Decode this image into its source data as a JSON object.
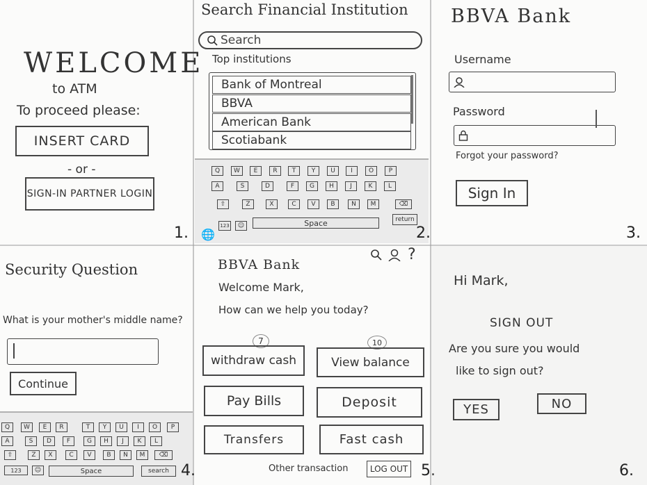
{
  "p1": {
    "title": "WELCOME",
    "subtitle": "to ATM",
    "proceed": "To proceed please:",
    "insert_card": "INSERT CARD",
    "or": "- or -",
    "signin_partner": "SIGN-IN PARTNER LOGIN",
    "number": "1."
  },
  "p2": {
    "title": "Search Financial Institution",
    "search_placeholder": "Search",
    "top_label": "Top institutions",
    "institutions": [
      "Bank of Montreal",
      "BBVA",
      "American Bank",
      "Scotiabank"
    ],
    "keyboard": {
      "row1": [
        "Q",
        "W",
        "E",
        "R",
        "T",
        "Y",
        "U",
        "I",
        "O",
        "P"
      ],
      "row2": [
        "A",
        "S",
        "D",
        "F",
        "G",
        "H",
        "J",
        "K",
        "L"
      ],
      "row3": [
        "Z",
        "X",
        "C",
        "V",
        "B",
        "N",
        "M"
      ],
      "num_key": "123",
      "space": "Space",
      "return": "return"
    },
    "number": "2."
  },
  "p3": {
    "title": "BBVA Bank",
    "username_label": "Username",
    "password_label": "Password",
    "forgot": "Forgot your password?",
    "signin": "Sign In",
    "number": "3."
  },
  "p4": {
    "title": "Security Question",
    "question": "What is your mother's middle name?",
    "continue": "Continue",
    "keyboard": {
      "row1": [
        "Q",
        "W",
        "E",
        "R",
        "T",
        "Y",
        "U",
        "I",
        "O",
        "P"
      ],
      "row2": [
        "A",
        "S",
        "D",
        "F",
        "G",
        "H",
        "J",
        "K",
        "L"
      ],
      "row3": [
        "Z",
        "X",
        "C",
        "V",
        "B",
        "N",
        "M"
      ],
      "num_key": "123",
      "space": "Space",
      "search": "search"
    },
    "number": "4."
  },
  "p5": {
    "title": "BBVA Bank",
    "welcome": "Welcome Mark,",
    "help": "How can we help you today?",
    "badge_withdraw": "7",
    "badge_balance": "10",
    "withdraw": "withdraw cash",
    "view_balance": "View balance",
    "pay_bills": "Pay Bills",
    "deposit": "Deposit",
    "transfers": "Transfers",
    "fast_cash": "Fast cash",
    "other": "Other transaction",
    "logout": "LOG OUT",
    "help_icon_glyph": "?",
    "number": "5."
  },
  "p6": {
    "greeting": "Hi Mark,",
    "title": "SIGN OUT",
    "question_l1": "Are you sure you would",
    "question_l2": "like to sign out?",
    "yes": "YES",
    "no": "NO",
    "number": "6."
  }
}
